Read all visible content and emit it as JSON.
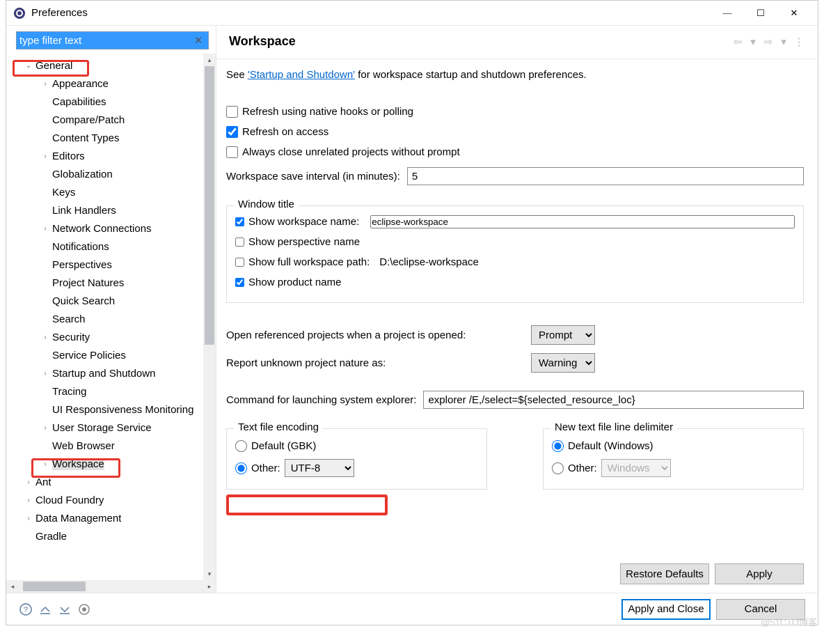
{
  "window": {
    "title": "Preferences"
  },
  "filter": {
    "placeholder": "type filter text"
  },
  "tree": {
    "items": [
      {
        "label": "General",
        "level": 1,
        "expanded": true,
        "hasChildren": true
      },
      {
        "label": "Appearance",
        "level": 2,
        "hasChildren": true
      },
      {
        "label": "Capabilities",
        "level": 2
      },
      {
        "label": "Compare/Patch",
        "level": 2
      },
      {
        "label": "Content Types",
        "level": 2
      },
      {
        "label": "Editors",
        "level": 2,
        "hasChildren": true
      },
      {
        "label": "Globalization",
        "level": 2
      },
      {
        "label": "Keys",
        "level": 2
      },
      {
        "label": "Link Handlers",
        "level": 2
      },
      {
        "label": "Network Connections",
        "level": 2,
        "hasChildren": true
      },
      {
        "label": "Notifications",
        "level": 2
      },
      {
        "label": "Perspectives",
        "level": 2
      },
      {
        "label": "Project Natures",
        "level": 2
      },
      {
        "label": "Quick Search",
        "level": 2
      },
      {
        "label": "Search",
        "level": 2
      },
      {
        "label": "Security",
        "level": 2,
        "hasChildren": true
      },
      {
        "label": "Service Policies",
        "level": 2
      },
      {
        "label": "Startup and Shutdown",
        "level": 2,
        "hasChildren": true
      },
      {
        "label": "Tracing",
        "level": 2
      },
      {
        "label": "UI Responsiveness Monitoring",
        "level": 2
      },
      {
        "label": "User Storage Service",
        "level": 2,
        "hasChildren": true
      },
      {
        "label": "Web Browser",
        "level": 2
      },
      {
        "label": "Workspace",
        "level": 2,
        "hasChildren": true,
        "selected": true
      },
      {
        "label": "Ant",
        "level": 1,
        "hasChildren": true
      },
      {
        "label": "Cloud Foundry",
        "level": 1,
        "hasChildren": true
      },
      {
        "label": "Data Management",
        "level": 1,
        "hasChildren": true
      },
      {
        "label": "Gradle",
        "level": 1
      }
    ]
  },
  "content": {
    "heading": "Workspace",
    "intro_prefix": "See ",
    "intro_link": "'Startup and Shutdown'",
    "intro_suffix": " for workspace startup and shutdown preferences.",
    "checks": {
      "refresh_hooks": "Refresh using native hooks or polling",
      "refresh_access": "Refresh on access",
      "close_unrelated": "Always close unrelated projects without prompt"
    },
    "save_interval_label": "Workspace save interval (in minutes):",
    "save_interval_value": "5",
    "window_title": {
      "legend": "Window title",
      "show_ws_name": "Show workspace name:",
      "ws_name_value": "eclipse-workspace",
      "show_perspective": "Show perspective name",
      "show_full_path": "Show full workspace path:",
      "full_path_value": "D:\\eclipse-workspace",
      "show_product": "Show product name"
    },
    "open_referenced_label": "Open referenced projects when a project is opened:",
    "open_referenced_value": "Prompt",
    "report_nature_label": "Report unknown project nature as:",
    "report_nature_value": "Warning",
    "explorer_label": "Command for launching system explorer:",
    "explorer_value": "explorer /E,/select=${selected_resource_loc}",
    "encoding": {
      "legend": "Text file encoding",
      "default_label": "Default (GBK)",
      "other_label": "Other:",
      "other_value": "UTF-8"
    },
    "delimiter": {
      "legend": "New text file line delimiter",
      "default_label": "Default (Windows)",
      "other_label": "Other:",
      "other_value": "Windows"
    },
    "restore_defaults": "Restore Defaults",
    "apply": "Apply"
  },
  "footer": {
    "apply_close": "Apply and Close",
    "cancel": "Cancel"
  },
  "watermark": "@51CTO博客"
}
